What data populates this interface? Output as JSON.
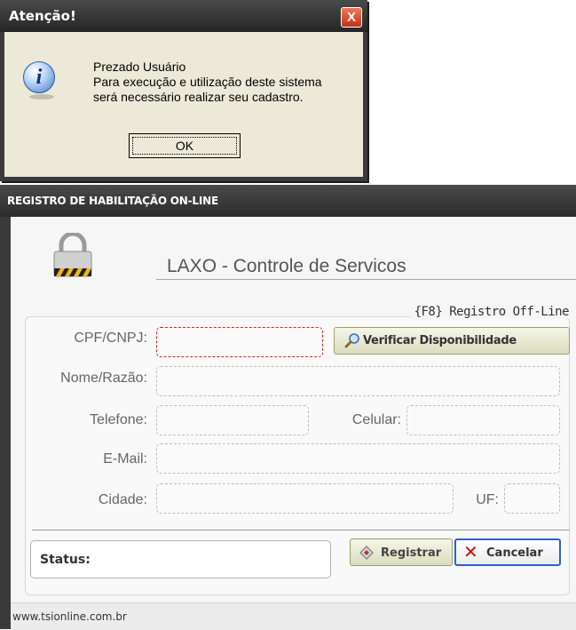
{
  "alert": {
    "title": "Atenção!",
    "close_glyph": "X",
    "icon": "info-icon",
    "message_lines": [
      "Prezado Usuário",
      "Para execução e utilização deste sistema",
      "será necessário realizar seu cadastro."
    ],
    "ok_label": "OK"
  },
  "registration": {
    "title": "REGISTRO DE HABILITAÇÃO ON-LINE",
    "app_name": "LAXO - Controle de Servicos",
    "offline_link": "{F8} Registro Off-Line",
    "fields": {
      "cpf_label": "CPF/CNPJ:",
      "cpf_value": "",
      "nome_label": "Nome/Razão:",
      "nome_value": "",
      "telefone_label": "Telefone:",
      "telefone_value": "",
      "celular_label": "Celular:",
      "celular_value": "",
      "email_label": "E-Mail:",
      "email_value": "",
      "cidade_label": "Cidade:",
      "cidade_value": "",
      "uf_label": "UF:",
      "uf_value": ""
    },
    "verify_button": "Verificar Disponibilidade",
    "status_label": "Status:",
    "register_button": "Registrar",
    "cancel_button": "Cancelar",
    "footer_url": "www.tsionline.com.br"
  },
  "colors": {
    "error_border": "#e02020",
    "cancel_focus": "#2b63c4",
    "titlebar": "#2c2c2c"
  }
}
